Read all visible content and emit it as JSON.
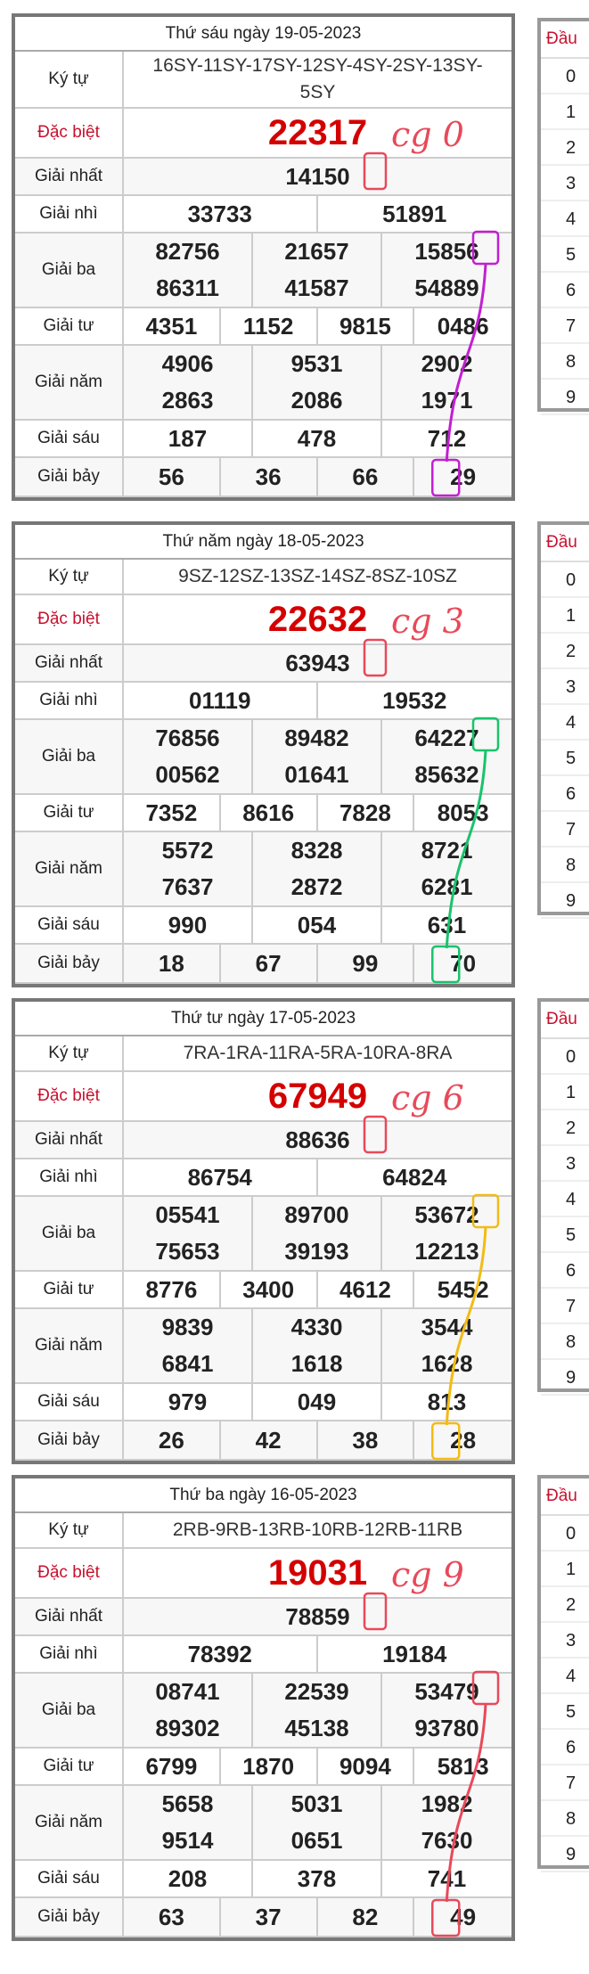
{
  "labels": {
    "ky_tu": "Ký tự",
    "dac_biet": "Đặc biệt",
    "giai_nhat": "Giải nhất",
    "giai_nhi": "Giải nhì",
    "giai_ba": "Giải ba",
    "giai_tu": "Giải tư",
    "giai_nam": "Giải năm",
    "giai_sau": "Giải sáu",
    "giai_bay": "Giải bảy",
    "dau": "Đầu",
    "dau_values": [
      "0",
      "1",
      "2",
      "3",
      "4",
      "5",
      "6",
      "7",
      "8",
      "9"
    ]
  },
  "draws": [
    {
      "date": "Thứ sáu ngày 19-05-2023",
      "ky_tu": "16SY-11SY-17SY-12SY-4SY-2SY-13SY-5SY",
      "dac_biet": "22317",
      "giai_nhat": "14150",
      "giai_nhi": [
        "33733",
        "51891"
      ],
      "giai_ba": [
        "82756",
        "21657",
        "15856",
        "86311",
        "41587",
        "54889"
      ],
      "giai_tu": [
        "4351",
        "1152",
        "9815",
        "0486"
      ],
      "giai_nam": [
        "4906",
        "9531",
        "2902",
        "2863",
        "2086",
        "1971"
      ],
      "giai_sau": [
        "187",
        "478",
        "712"
      ],
      "giai_bay": [
        "56",
        "36",
        "66",
        "29"
      ],
      "note": "cg 0",
      "note_color": "#e8495a",
      "line_color": "#c21fd1"
    },
    {
      "date": "Thứ năm ngày 18-05-2023",
      "ky_tu": "9SZ-12SZ-13SZ-14SZ-8SZ-10SZ",
      "dac_biet": "22632",
      "giai_nhat": "63943",
      "giai_nhi": [
        "01119",
        "19532"
      ],
      "giai_ba": [
        "76856",
        "89482",
        "64227",
        "00562",
        "01641",
        "85632"
      ],
      "giai_tu": [
        "7352",
        "8616",
        "7828",
        "8053"
      ],
      "giai_nam": [
        "5572",
        "8328",
        "8721",
        "7637",
        "2872",
        "6281"
      ],
      "giai_sau": [
        "990",
        "054",
        "631"
      ],
      "giai_bay": [
        "18",
        "67",
        "99",
        "70"
      ],
      "note": "cg 3",
      "note_color": "#e8495a",
      "line_color": "#19c36b"
    },
    {
      "date": "Thứ tư ngày 17-05-2023",
      "ky_tu": "7RA-1RA-11RA-5RA-10RA-8RA",
      "dac_biet": "67949",
      "giai_nhat": "88636",
      "giai_nhi": [
        "86754",
        "64824"
      ],
      "giai_ba": [
        "05541",
        "89700",
        "53672",
        "75653",
        "39193",
        "12213"
      ],
      "giai_tu": [
        "8776",
        "3400",
        "4612",
        "5452"
      ],
      "giai_nam": [
        "9839",
        "4330",
        "3544",
        "6841",
        "1618",
        "1628"
      ],
      "giai_sau": [
        "979",
        "049",
        "813"
      ],
      "giai_bay": [
        "26",
        "42",
        "38",
        "28"
      ],
      "note": "cg 6",
      "note_color": "#e8495a",
      "line_color": "#f2bb16"
    },
    {
      "date": "Thứ ba ngày 16-05-2023",
      "ky_tu": "2RB-9RB-13RB-10RB-12RB-11RB",
      "dac_biet": "19031",
      "giai_nhat": "78859",
      "giai_nhi": [
        "78392",
        "19184"
      ],
      "giai_ba": [
        "08741",
        "22539",
        "53479",
        "89302",
        "45138",
        "93780"
      ],
      "giai_tu": [
        "6799",
        "1870",
        "9094",
        "5813"
      ],
      "giai_nam": [
        "5658",
        "5031",
        "1982",
        "9514",
        "0651",
        "7630"
      ],
      "giai_sau": [
        "208",
        "378",
        "741"
      ],
      "giai_bay": [
        "63",
        "37",
        "82",
        "49"
      ],
      "note": "cg 9",
      "note_color": "#e8495a",
      "line_color": "#e8495a"
    }
  ]
}
